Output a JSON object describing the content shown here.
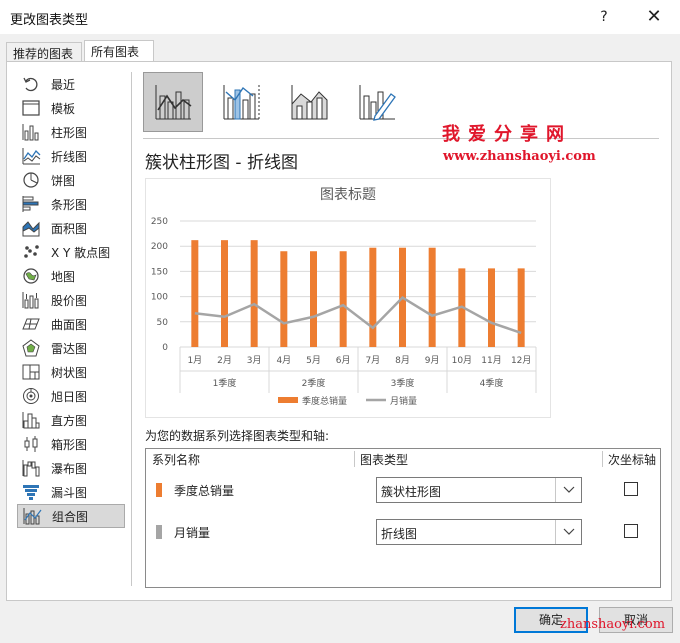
{
  "dialog": {
    "title": "更改图表类型",
    "help": "?",
    "close": "✕"
  },
  "tabs": [
    {
      "label": "推荐的图表",
      "active": false
    },
    {
      "label": "所有图表",
      "active": true
    }
  ],
  "categories": [
    {
      "label": "最近",
      "icon": "recent-icon"
    },
    {
      "label": "模板",
      "icon": "template-icon"
    },
    {
      "label": "柱形图",
      "icon": "column-chart-icon"
    },
    {
      "label": "折线图",
      "icon": "line-chart-icon"
    },
    {
      "label": "饼图",
      "icon": "pie-chart-icon"
    },
    {
      "label": "条形图",
      "icon": "bar-chart-icon"
    },
    {
      "label": "面积图",
      "icon": "area-chart-icon"
    },
    {
      "label": "X Y 散点图",
      "icon": "scatter-chart-icon"
    },
    {
      "label": "地图",
      "icon": "map-chart-icon"
    },
    {
      "label": "股价图",
      "icon": "stock-chart-icon"
    },
    {
      "label": "曲面图",
      "icon": "surface-chart-icon"
    },
    {
      "label": "雷达图",
      "icon": "radar-chart-icon"
    },
    {
      "label": "树状图",
      "icon": "treemap-chart-icon"
    },
    {
      "label": "旭日图",
      "icon": "sunburst-chart-icon"
    },
    {
      "label": "直方图",
      "icon": "histogram-chart-icon"
    },
    {
      "label": "箱形图",
      "icon": "boxplot-chart-icon"
    },
    {
      "label": "瀑布图",
      "icon": "waterfall-chart-icon"
    },
    {
      "label": "漏斗图",
      "icon": "funnel-chart-icon"
    },
    {
      "label": "组合图",
      "icon": "combo-chart-icon",
      "selected": true
    }
  ],
  "subtypes": [
    {
      "icon": "clustered-column-line-icon",
      "selected": true
    },
    {
      "icon": "clustered-column-line-secondary-icon",
      "selected": false
    },
    {
      "icon": "stacked-area-clustered-column-icon",
      "selected": false
    },
    {
      "icon": "custom-combination-icon",
      "selected": false
    }
  ],
  "watermark": {
    "line1": "我爱分享网",
    "line2": "www.zhanshaoyi.com",
    "line3": "zhanshaoyi.com"
  },
  "heading": "簇状柱形图 - 折线图",
  "chart_data": {
    "type": "bar",
    "title": "图表标题",
    "ylim": [
      0,
      250
    ],
    "yticks": [
      0,
      50,
      100,
      150,
      200,
      250
    ],
    "categories": [
      "1月",
      "2月",
      "3月",
      "4月",
      "5月",
      "6月",
      "7月",
      "8月",
      "9月",
      "10月",
      "11月",
      "12月"
    ],
    "groups": [
      "1季度",
      "2季度",
      "3季度",
      "4季度"
    ],
    "series": [
      {
        "name": "季度总销量",
        "chart": "bar",
        "color": "#ed7d31",
        "values": [
          212,
          212,
          212,
          190,
          190,
          190,
          197,
          197,
          197,
          156,
          156,
          156
        ]
      },
      {
        "name": "月销量",
        "chart": "line",
        "color": "#a5a5a5",
        "values": [
          67,
          60,
          85,
          47,
          60,
          83,
          38,
          98,
          62,
          80,
          48,
          28
        ]
      }
    ],
    "legend": "bottom",
    "grid": true
  },
  "series_prompt": "为您的数据系列选择图表类型和轴:",
  "grid_headers": {
    "name": "系列名称",
    "type": "图表类型",
    "axis": "次坐标轴"
  },
  "series_rows": [
    {
      "name": "季度总销量",
      "color": "#ed7d31",
      "chart_type": "簇状柱形图",
      "secondary_axis": false
    },
    {
      "name": "月销量",
      "color": "#a5a5a5",
      "chart_type": "折线图",
      "secondary_axis": false
    }
  ],
  "buttons": {
    "ok": "确定",
    "cancel": "取消"
  }
}
